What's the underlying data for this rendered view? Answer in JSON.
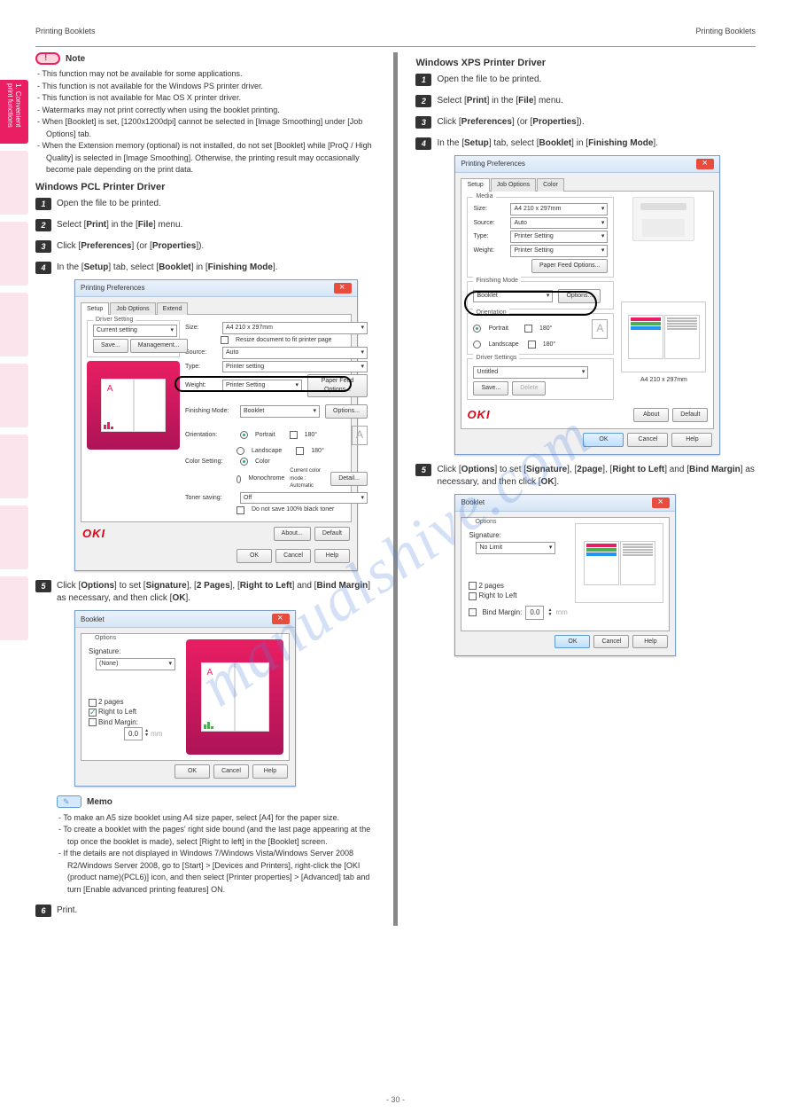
{
  "header": {
    "left": "Printing Booklets",
    "right": "Printing Booklets"
  },
  "sidebar": {
    "active": "1. Convenient print functions"
  },
  "watermark": "manualshive.com",
  "page_number": "- 30 -",
  "left_col": {
    "note_label": "Note",
    "notes": [
      "This function may not be available for some applications.",
      "This function is not available for the Windows PS printer driver.",
      "This function is not available for Mac OS X printer driver.",
      "Watermarks may not print correctly when using the booklet printing.",
      "When [Booklet] is set, [1200x1200dpi] cannot be selected in [Image Smoothing] under [Job Options] tab.",
      "When the Extension memory (optional) is not installed, do not set [Booklet] while [ProQ / High Quality] is selected in [Image Smoothing]. Otherwise, the printing result may occasionally become pale depending on the print data."
    ],
    "driver_title": "Windows PCL Printer Driver",
    "steps": [
      "Open the file to be printed.",
      {
        "text_parts": [
          "Select [",
          "Print",
          "] in the [",
          "File",
          "] menu."
        ]
      },
      {
        "text_parts": [
          "Click [",
          "Preferences",
          "] (or [",
          "Properties",
          "])."
        ]
      },
      {
        "text_parts": [
          "In the [",
          "Setup",
          "] tab, select [",
          "Booklet",
          "] in [",
          "Finishing Mode",
          "]."
        ]
      }
    ],
    "dialog1": {
      "title": "Printing Preferences",
      "tabs": [
        "Setup",
        "Job Options",
        "Extend"
      ],
      "driver_setting_label": "Driver Setting",
      "driver_setting_value": "Current setting",
      "save_btn": "Save...",
      "manage_btn": "Management...",
      "media": {
        "legend": "",
        "size_label": "Size:",
        "size_value": "A4 210 x 297mm",
        "resize_check": "Resize document to fit printer page",
        "source_label": "Source:",
        "source_value": "Auto",
        "type_label": "Type:",
        "type_value": "Printer setting",
        "weight_label": "Weight:",
        "weight_value": "Printer Setting",
        "feed_btn": "Paper Feed Options..."
      },
      "finishing_label": "Finishing Mode:",
      "finishing_value": "Booklet",
      "options_btn": "Options...",
      "orientation_label": "Orientation:",
      "portrait": "Portrait",
      "landscape": "Landscape",
      "rot180": "180°",
      "color_label": "Color Setting:",
      "color": "Color",
      "mono": "Monochrome",
      "color_mode_text": "Current color mode : Automatic",
      "detail_btn": "Detail...",
      "toner_label": "Toner saving:",
      "toner_value": "Off",
      "toner_check": "Do not save 100% black toner",
      "about_btn": "About...",
      "default_btn": "Default",
      "ok": "OK",
      "cancel": "Cancel",
      "help": "Help"
    },
    "step5": {
      "text_parts": [
        "Click [",
        "Options",
        "] to set [",
        "Signature",
        "], [",
        "2 Pages",
        "], [",
        "Right to Left",
        "] and [",
        "Bind Margin",
        "] as necessary, and then click [",
        "OK",
        "]."
      ]
    },
    "dialog2": {
      "title": "Booklet",
      "options_legend": "Options",
      "signature_label": "Signature:",
      "signature_value": "(None)",
      "two_pages": "2 pages",
      "right_to_left": "Right to Left",
      "bind_margin": "Bind Margin:",
      "bind_value": "0.0",
      "unit": "mm",
      "ok": "OK",
      "cancel": "Cancel",
      "help": "Help"
    },
    "memo_label": "Memo",
    "memos": [
      "To make an A5 size booklet using A4 size paper, select [A4] for the paper size.",
      "To create a booklet with the pages' right side bound (and the last page appearing at the top once the booklet is made), select [Right to left] in the [Booklet] screen.",
      "If the details are not displayed in Windows 7/Windows Vista/Windows Server 2008 R2/Windows Server 2008, go to [Start] > [Devices and Printers], right-click the [OKI (product name)(PCL6)] icon, and then select [Printer properties] > [Advanced] tab and turn [Enable advanced printing features] ON."
    ],
    "step6": "Print."
  },
  "right_col": {
    "driver_title": "Windows XPS Printer Driver",
    "steps": [
      "Open the file to be printed.",
      {
        "text_parts": [
          "Select [",
          "Print",
          "] in the [",
          "File",
          "] menu."
        ]
      },
      {
        "text_parts": [
          "Click [",
          "Preferences",
          "] (or [",
          "Properties",
          "])."
        ]
      },
      {
        "text_parts": [
          "In the [",
          "Setup",
          "] tab, select [",
          "Booklet",
          "] in [",
          "Finishing Mode",
          "]."
        ]
      }
    ],
    "dialog1": {
      "title": "Printing Preferences",
      "tabs": [
        "Setup",
        "Job Options",
        "Color"
      ],
      "media_legend": "Media",
      "size_label": "Size:",
      "size_value": "A4 210 x 297mm",
      "source_label": "Source:",
      "source_value": "Auto",
      "type_label": "Type:",
      "type_value": "Printer Setting",
      "weight_label": "Weight:",
      "weight_value": "Printer Setting",
      "feed_btn": "Paper Feed Options...",
      "finishing_legend": "Finishing Mode",
      "finishing_value": "Booklet",
      "options_btn": "Options...",
      "orientation_legend": "Orientation",
      "portrait": "Portrait",
      "landscape": "Landscape",
      "rot180": "180°",
      "driver_legend": "Driver Settings",
      "driver_value": "Untitled",
      "save_btn": "Save...",
      "delete_btn": "Delete",
      "preview_caption": "A4 210 x 297mm",
      "about_btn": "About",
      "default_btn": "Default",
      "ok": "OK",
      "cancel": "Cancel",
      "help": "Help"
    },
    "step5": {
      "text_parts": [
        "Click [",
        "Options",
        "] to set [",
        "Signature",
        "], [",
        "2page",
        "], [",
        "Right to Left",
        "] and [",
        "Bind Margin",
        "] as necessary, and then click [",
        "OK",
        "]."
      ]
    },
    "dialog2": {
      "title": "Booklet",
      "options_legend": "Options",
      "signature_label": "Signature:",
      "signature_value": "No Limit",
      "two_pages": "2 pages",
      "right_to_left": "Right to Left",
      "bind_margin": "Bind Margin:",
      "bind_value": "0.0",
      "unit": "mm",
      "ok": "OK",
      "cancel": "Cancel",
      "help": "Help"
    }
  }
}
